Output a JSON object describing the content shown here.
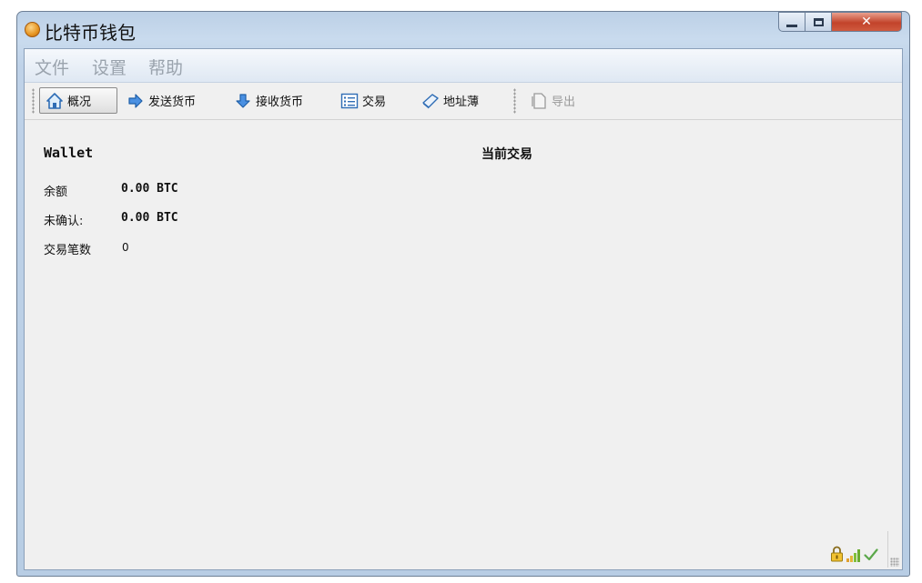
{
  "window": {
    "title": "比特币钱包"
  },
  "menu": {
    "items": [
      {
        "label": "文件"
      },
      {
        "label": "设置"
      },
      {
        "label": "帮助"
      }
    ]
  },
  "toolbar": {
    "overview": "概况",
    "send": "发送货币",
    "receive": "接收货币",
    "transactions": "交易",
    "address_book": "地址薄",
    "export": "导出"
  },
  "wallet": {
    "title": "Wallet",
    "balance_label": "余额",
    "balance_value": "0.00 BTC",
    "unconfirmed_label": "未确认:",
    "unconfirmed_value": "0.00 BTC",
    "tx_count_label": "交易笔数",
    "tx_count_value": "0"
  },
  "recent": {
    "title": "当前交易"
  },
  "status": {
    "icons": [
      "lock-icon",
      "signal-bars-icon",
      "sync-check-icon"
    ]
  },
  "colors": {
    "accent": "#f7931a",
    "titlebar": "#c9dbee",
    "close_button": "#c2432b"
  }
}
